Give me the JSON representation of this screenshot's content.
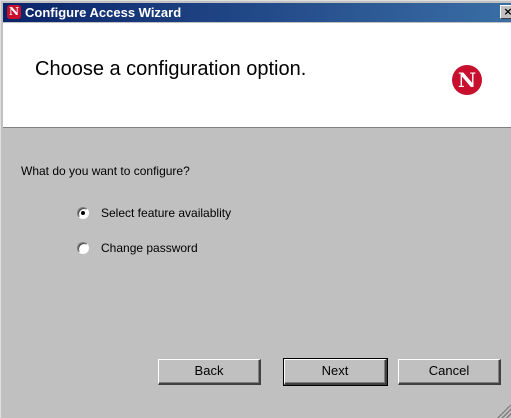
{
  "window": {
    "title": "Configure Access Wizard",
    "app_icon_letter": "N",
    "close_glyph": "×"
  },
  "header": {
    "title": "Choose a configuration option.",
    "logo_letter": "N"
  },
  "body": {
    "question": "What do you want to configure?",
    "options": [
      {
        "label": "Select feature availablity",
        "checked": true
      },
      {
        "label": "Change password",
        "checked": false
      }
    ]
  },
  "buttons": {
    "back": "Back",
    "next": "Next",
    "cancel": "Cancel"
  },
  "colors": {
    "titlebar_start": "#0a246a",
    "titlebar_end": "#3a6ea5",
    "dialog_bg": "#c0c0c0",
    "brand_red": "#c8102e"
  }
}
